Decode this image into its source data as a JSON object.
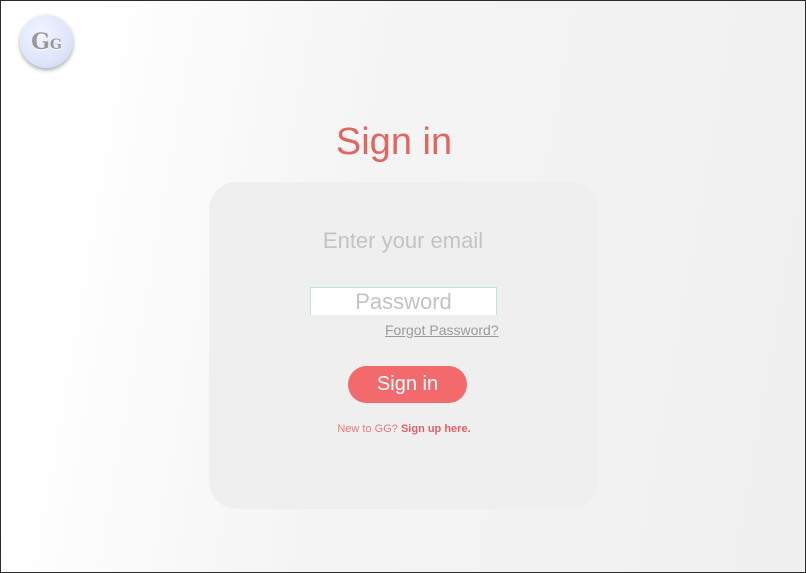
{
  "logo": {
    "letter_large": "G",
    "letter_small": "G"
  },
  "title": "Sign in",
  "form": {
    "email_placeholder": "Enter your email",
    "password_placeholder": "Password",
    "forgot_password": "Forgot Password?",
    "submit_label": "Sign in",
    "signup_prompt": "New to GG?",
    "signup_link": "Sign up here."
  },
  "colors": {
    "accent": "#f26a6c",
    "title": "#e0665f",
    "card_background": "#efefef"
  }
}
